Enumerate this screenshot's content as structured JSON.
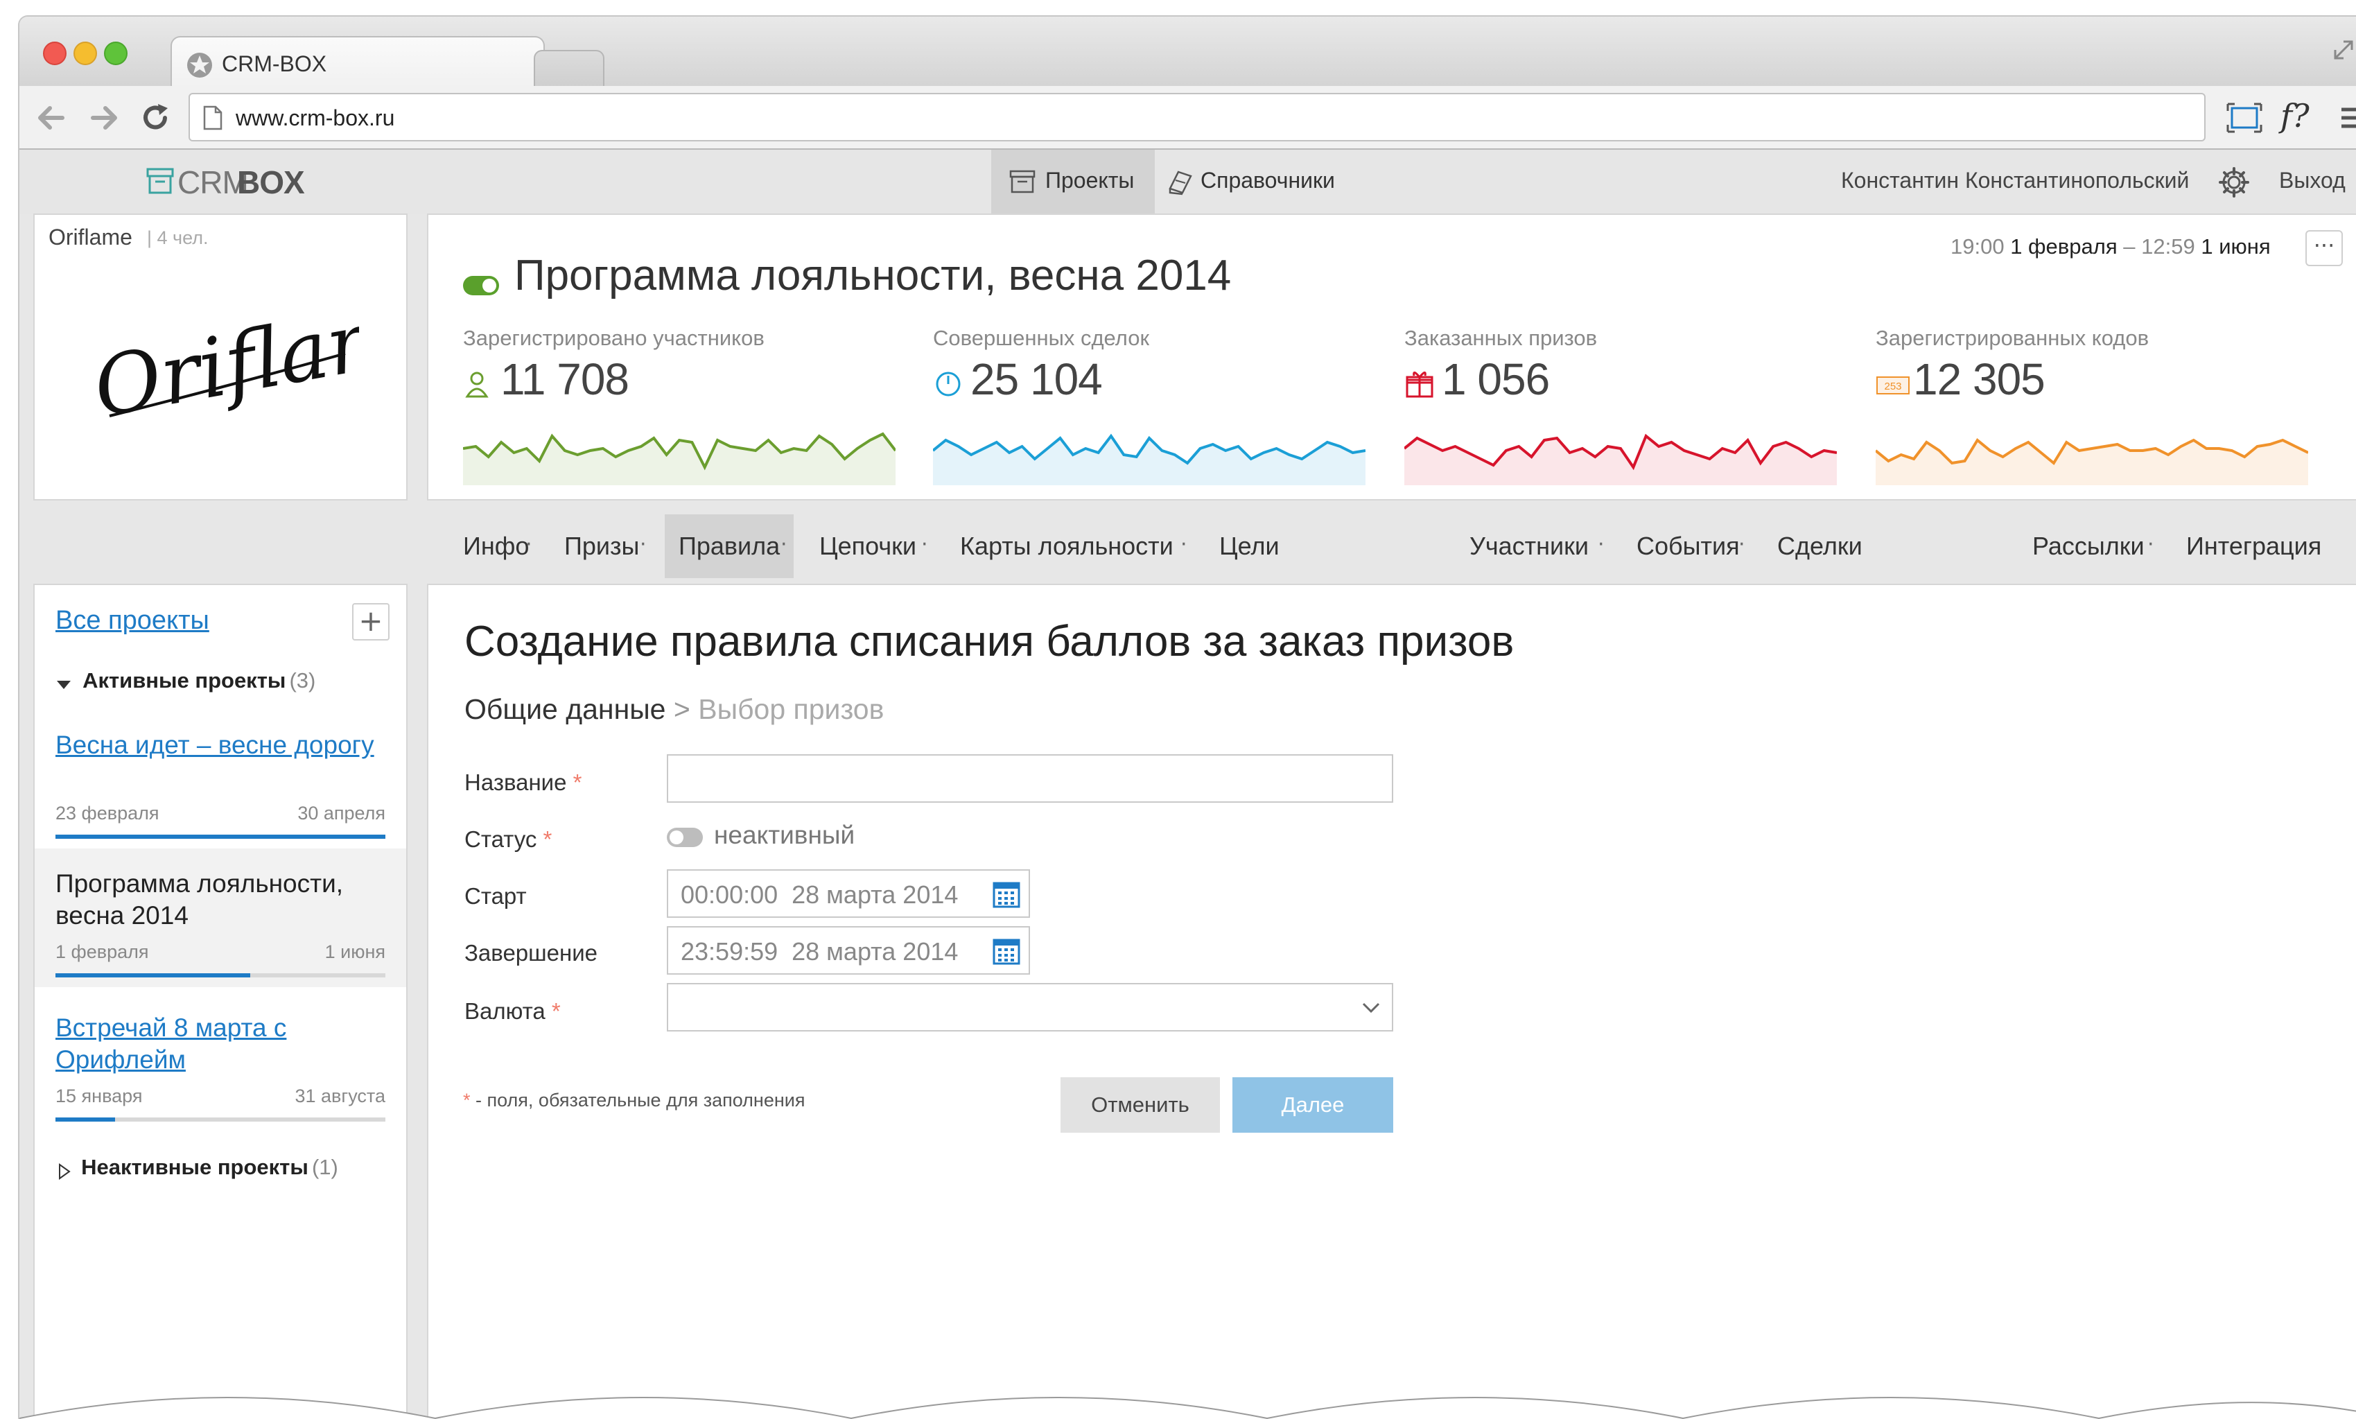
{
  "browser": {
    "tab_title": "CRM-BOX",
    "url": "www.crm-box.ru"
  },
  "app": {
    "logo_crm": "CRM",
    "logo_box": "BOX",
    "nav": {
      "projects": "Проекты",
      "directories": "Справочники"
    },
    "user_name": "Константин Константинопольский",
    "logout": "Выход"
  },
  "company": {
    "name": "Oriflame",
    "members": "4 чел.",
    "logo_text": "Oriflame"
  },
  "project": {
    "title": "Программа лояльности, весна 2014",
    "date_start_time": "19:00",
    "date_start_day": "1 февраля",
    "date_sep": "–",
    "date_end_time": "12:59",
    "date_end_day": "1 июня",
    "menu": "···"
  },
  "stats": [
    {
      "label": "Зарегистрировано участников",
      "value": "11 708",
      "color": "#6b9e2f",
      "fill": "#edf3e6",
      "icon": "user-icon"
    },
    {
      "label": "Совершенных сделок",
      "value": "25 104",
      "color": "#1b9fd6",
      "fill": "#e4f3fa",
      "icon": "power-icon"
    },
    {
      "label": "Заказанных призов",
      "value": "1 056",
      "color": "#d7142c",
      "fill": "#fbe6e9",
      "icon": "gift-icon"
    },
    {
      "label": "Зарегистрированных кодов",
      "value": "12 305",
      "color": "#f0922b",
      "fill": "#fdf1e5",
      "icon": "code-icon",
      "badge": "253"
    }
  ],
  "sparklines": [
    [
      0.55,
      0.6,
      0.35,
      0.7,
      0.45,
      0.55,
      0.25,
      0.85,
      0.5,
      0.4,
      0.5,
      0.55,
      0.35,
      0.5,
      0.6,
      0.8,
      0.4,
      0.75,
      0.7,
      0.1,
      0.75,
      0.6,
      0.55,
      0.5,
      0.75,
      0.45,
      0.55,
      0.5,
      0.85,
      0.65,
      0.3,
      0.55,
      0.75,
      0.9,
      0.5
    ],
    [
      0.5,
      0.75,
      0.6,
      0.4,
      0.55,
      0.7,
      0.45,
      0.6,
      0.3,
      0.55,
      0.8,
      0.4,
      0.55,
      0.45,
      0.85,
      0.4,
      0.35,
      0.8,
      0.5,
      0.4,
      0.2,
      0.55,
      0.65,
      0.5,
      0.6,
      0.3,
      0.45,
      0.55,
      0.4,
      0.3,
      0.5,
      0.7,
      0.6,
      0.45,
      0.5
    ],
    [
      0.55,
      0.8,
      0.65,
      0.5,
      0.6,
      0.45,
      0.3,
      0.15,
      0.5,
      0.6,
      0.35,
      0.75,
      0.8,
      0.45,
      0.55,
      0.35,
      0.6,
      0.55,
      0.1,
      0.85,
      0.6,
      0.7,
      0.5,
      0.4,
      0.3,
      0.55,
      0.45,
      0.75,
      0.2,
      0.6,
      0.7,
      0.55,
      0.35,
      0.5,
      0.45
    ],
    [
      0.5,
      0.25,
      0.4,
      0.3,
      0.7,
      0.5,
      0.2,
      0.25,
      0.75,
      0.5,
      0.35,
      0.55,
      0.7,
      0.45,
      0.2,
      0.7,
      0.5,
      0.55,
      0.6,
      0.65,
      0.5,
      0.5,
      0.55,
      0.4,
      0.6,
      0.75,
      0.55,
      0.55,
      0.5,
      0.35,
      0.6,
      0.65,
      0.75,
      0.6,
      0.45
    ]
  ],
  "tabs": {
    "left": [
      "Инфо",
      "Призы",
      "Правила",
      "Цепочки",
      "Карты лояльности",
      "Цели"
    ],
    "middle": [
      "Участники",
      "События",
      "Сделки"
    ],
    "right": [
      "Рассылки",
      "Интеграция"
    ]
  },
  "sidebar": {
    "all_projects": "Все проекты",
    "add": "+",
    "active_label": "Активные  проекты",
    "active_count": "(3)",
    "inactive_label": "Неактивные проекты",
    "inactive_count": "(1)",
    "projects": [
      {
        "title": "Весна идет – весне дорогу",
        "start": "23 февраля",
        "end": "30 апреля",
        "progress": 100
      },
      {
        "title": "Программа лояльности, весна 2014",
        "start": "1 февраля",
        "end": "1 июня",
        "progress": 59
      },
      {
        "title": "Встречай 8 марта с Орифлейм",
        "start": "15 января",
        "end": "31 августа",
        "progress": 18
      }
    ]
  },
  "form": {
    "heading": "Создание правила списания баллов за заказ призов",
    "step_current": "Общие данные",
    "step_sep": ">",
    "step_next": "Выбор призов",
    "fields": {
      "name_label": "Название",
      "status_label": "Статус",
      "status_value": "неактивный",
      "start_label": "Старт",
      "start_value": "00:00:00  28 марта 2014",
      "end_label": "Завершение",
      "end_value": "23:59:59  28 марта 2014",
      "currency_label": "Валюта"
    },
    "required_star": "*",
    "required_note": " - поля, обязательные для заполнения",
    "cancel": "Отменить",
    "next": "Далее"
  }
}
